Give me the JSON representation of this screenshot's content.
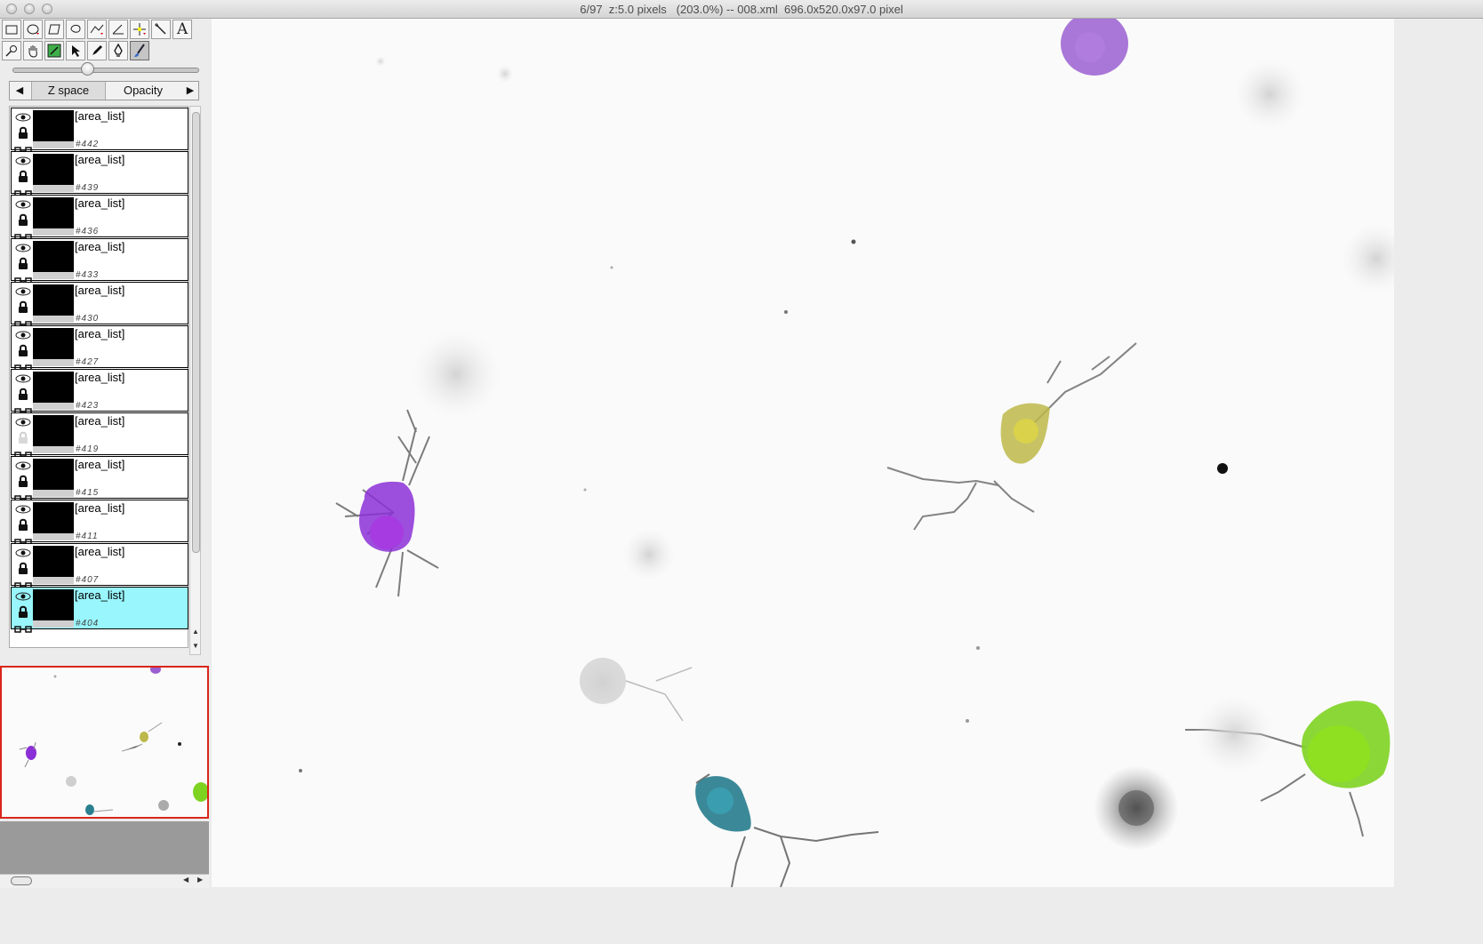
{
  "window": {
    "title": "6/97  z:5.0 pixels   (203.0%) -- 008.xml  696.0x520.0x97.0 pixel"
  },
  "toolbar": {
    "tools": [
      {
        "name": "rectangle-tool-icon"
      },
      {
        "name": "oval-tool-icon"
      },
      {
        "name": "polygon-tool-icon"
      },
      {
        "name": "freehand-tool-icon"
      },
      {
        "name": "segmented-line-tool-icon"
      },
      {
        "name": "angle-tool-icon"
      },
      {
        "name": "point-tool-icon"
      },
      {
        "name": "wand-tool-icon"
      },
      {
        "name": "text-tool-icon"
      },
      {
        "name": "zoom-tool-icon"
      },
      {
        "name": "hand-tool-icon"
      },
      {
        "name": "align-tool-icon"
      },
      {
        "name": "select-arrow-icon"
      },
      {
        "name": "pencil-icon"
      },
      {
        "name": "pen-icon"
      },
      {
        "name": "brush-icon"
      }
    ],
    "text_tool_label": "A",
    "active_tool": "brush-icon"
  },
  "slider": {
    "level": 0.4
  },
  "tabs": {
    "prev_arrow": "◀",
    "next_arrow": "▶",
    "items": [
      {
        "label": "Z space",
        "selected": true
      },
      {
        "label": "Opacity",
        "selected": false
      }
    ]
  },
  "layers": [
    {
      "name": "[area_list]",
      "id": "#442",
      "locked": true,
      "selected": false
    },
    {
      "name": "[area_list]",
      "id": "#439",
      "locked": true,
      "selected": false
    },
    {
      "name": "[area_list]",
      "id": "#436",
      "locked": true,
      "selected": false
    },
    {
      "name": "[area_list]",
      "id": "#433",
      "locked": true,
      "selected": false
    },
    {
      "name": "[area_list]",
      "id": "#430",
      "locked": true,
      "selected": false
    },
    {
      "name": "[area_list]",
      "id": "#427",
      "locked": true,
      "selected": false
    },
    {
      "name": "[area_list]",
      "id": "#423",
      "locked": true,
      "selected": false
    },
    {
      "name": "[area_list]",
      "id": "#419",
      "locked": false,
      "selected": false
    },
    {
      "name": "[area_list]",
      "id": "#415",
      "locked": true,
      "selected": false
    },
    {
      "name": "[area_list]",
      "id": "#411",
      "locked": true,
      "selected": false
    },
    {
      "name": "[area_list]",
      "id": "#407",
      "locked": true,
      "selected": false
    },
    {
      "name": "[area_list]",
      "id": "#404",
      "locked": true,
      "selected": true
    }
  ],
  "colors": {
    "selected_row": "#98f6fc",
    "navigator_frame": "#d9251a",
    "cell_purple_top": "#9a5fd0",
    "cell_violet": "#8b2fd6",
    "cell_olive": "#bdb84a",
    "cell_teal": "#2a7f8f",
    "cell_green": "#7ed321"
  }
}
